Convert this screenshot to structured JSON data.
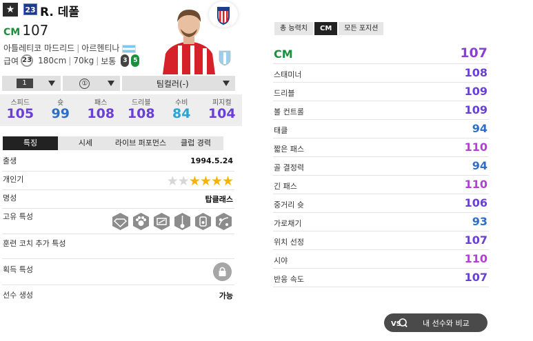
{
  "header": {
    "favorite_icon": "star-icon",
    "season_badge": "23",
    "player_name": "R. 데폴",
    "position": "CM",
    "overall": "107",
    "club": "아틀레티코 마드리드",
    "nation": "아르헨티나",
    "salary_label": "급여",
    "salary": "23",
    "height": "180cm",
    "weight": "70kg",
    "body_type": "보통",
    "foot_left": "3",
    "foot_right": "5"
  },
  "level_bar": {
    "enhance_level": "1",
    "team_color_level": "①",
    "team_color": "팀컬러(-)"
  },
  "summary_stats": [
    {
      "label": "스피드",
      "value": "105",
      "color": "#6a3fd6"
    },
    {
      "label": "슛",
      "value": "99",
      "color": "#2d6fc7"
    },
    {
      "label": "패스",
      "value": "108",
      "color": "#6a3fd6"
    },
    {
      "label": "드리블",
      "value": "108",
      "color": "#6a3fd6"
    },
    {
      "label": "수비",
      "value": "84",
      "color": "#2aa3d6"
    },
    {
      "label": "피지컬",
      "value": "104",
      "color": "#6a3fd6"
    }
  ],
  "left_tabs": [
    "특징",
    "시세",
    "라이브 퍼포먼스",
    "클럽 경력"
  ],
  "info": {
    "birth_label": "출생",
    "birth": "1994.5.24",
    "skill_label": "개인기",
    "skill_stars_on": 4,
    "skill_stars_total": 6,
    "reputation_label": "명성",
    "reputation": "탑클래스",
    "traits_label": "고유 특성",
    "coach_label": "훈련 코치 추가 특성",
    "acquired_label": "획득 특성",
    "generation_label": "선수 생성",
    "generation": "가능"
  },
  "right_tabs": [
    "총 능력치",
    "CM",
    "모든 포지션"
  ],
  "detail_stats": [
    {
      "name": "CM",
      "value": "107",
      "color": "#8a3fd6"
    },
    {
      "name": "스태미너",
      "value": "108",
      "color": "#6a3fd6"
    },
    {
      "name": "드리블",
      "value": "109",
      "color": "#6a3fd6"
    },
    {
      "name": "볼 컨트롤",
      "value": "109",
      "color": "#6a3fd6"
    },
    {
      "name": "태클",
      "value": "94",
      "color": "#2d6fc7"
    },
    {
      "name": "짧은 패스",
      "value": "110",
      "color": "#b43fd6"
    },
    {
      "name": "골 결정력",
      "value": "94",
      "color": "#2d6fc7"
    },
    {
      "name": "긴 패스",
      "value": "110",
      "color": "#b43fd6"
    },
    {
      "name": "중거리 슛",
      "value": "106",
      "color": "#6a3fd6"
    },
    {
      "name": "가로채기",
      "value": "93",
      "color": "#2d6fc7"
    },
    {
      "name": "위치 선정",
      "value": "107",
      "color": "#6a3fd6"
    },
    {
      "name": "시야",
      "value": "110",
      "color": "#b43fd6"
    },
    {
      "name": "반응 속도",
      "value": "107",
      "color": "#6a3fd6"
    }
  ],
  "compare_button": "내 선수와 비교"
}
